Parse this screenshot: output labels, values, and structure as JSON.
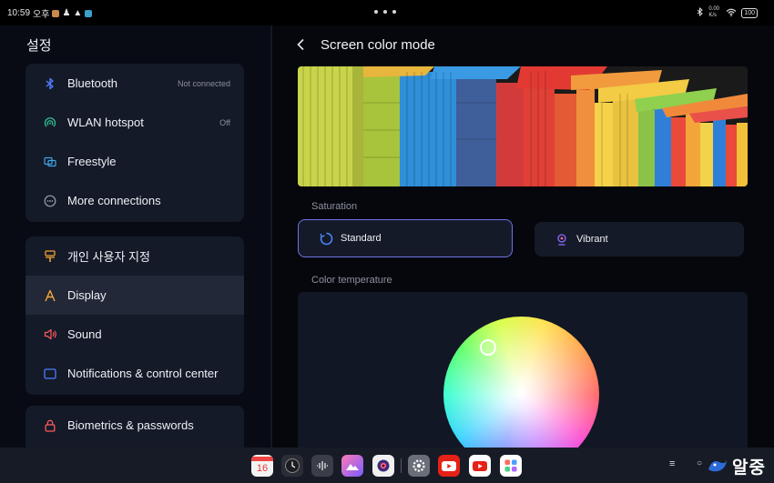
{
  "status_bar": {
    "time": "10:59",
    "ampm": "오후",
    "network_speed": "0.00 K/s",
    "battery": "100"
  },
  "sidebar": {
    "title": "설정",
    "groups": [
      [
        {
          "label": "Bluetooth",
          "value": "Not connected",
          "icon": "bluetooth-icon"
        },
        {
          "label": "WLAN hotspot",
          "value": "Off",
          "icon": "hotspot-icon"
        },
        {
          "label": "Freestyle",
          "value": "",
          "icon": "freestyle-icon"
        },
        {
          "label": "More connections",
          "value": "",
          "icon": "more-connections-icon"
        }
      ],
      [
        {
          "label": "개인 사용자 지정",
          "value": "",
          "icon": "personalization-icon"
        },
        {
          "label": "Display",
          "value": "",
          "icon": "display-icon",
          "selected": true
        },
        {
          "label": "Sound",
          "value": "",
          "icon": "sound-icon"
        },
        {
          "label": "Notifications & control center",
          "value": "",
          "icon": "notifications-icon"
        }
      ],
      [
        {
          "label": "Biometrics & passwords",
          "value": "",
          "icon": "lock-icon"
        }
      ]
    ]
  },
  "main": {
    "title": "Screen color mode",
    "saturation_label": "Saturation",
    "options": {
      "standard": "Standard",
      "vibrant": "Vibrant",
      "selected": "standard"
    },
    "color_temperature_label": "Color temperature"
  },
  "dock": {
    "calendar_day": "16",
    "menu_glyph": "≡",
    "watermark": "알중"
  },
  "colors": {
    "accent": "#6e73e6",
    "card": "#151a29",
    "background": "#05070c"
  }
}
